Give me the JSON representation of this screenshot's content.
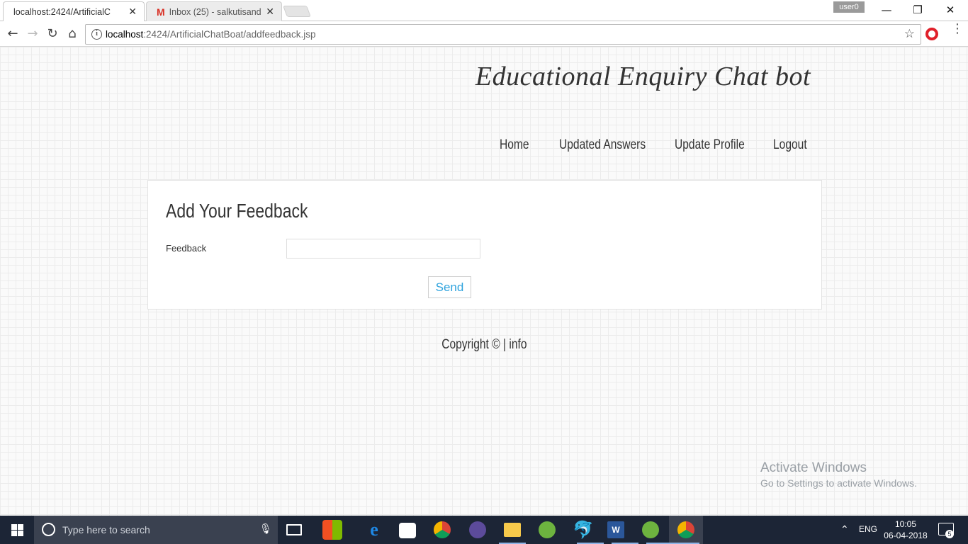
{
  "browser": {
    "tabs": [
      {
        "label": "localhost:2424/ArtificialC",
        "active": true
      },
      {
        "label": "Inbox (25) - salkutisande",
        "active": false,
        "icon": "gmail-icon"
      }
    ],
    "profile_name": "user0",
    "url_host": "localhost",
    "url_path": ":2424/ArtificialChatBoat/addfeedback.jsp"
  },
  "site": {
    "title": "Educational Enquiry Chat bot",
    "nav": [
      "Home",
      "Updated Answers",
      "Update Profile",
      "Logout"
    ]
  },
  "form": {
    "heading": "Add Your Feedback",
    "feedback_label": "Feedback",
    "feedback_value": "",
    "send_label": "Send"
  },
  "footer": {
    "text": "Copyright © | info"
  },
  "watermark": {
    "line1": "Activate Windows",
    "line2": "Go to Settings to activate Windows."
  },
  "taskbar": {
    "search_placeholder": "Type here to search",
    "language": "ENG",
    "time": "10:05",
    "date": "06-04-2018",
    "notifications": "5",
    "apps": [
      "task-view",
      "store-tiles",
      "edge",
      "store",
      "chrome",
      "eclipse",
      "file-explorer",
      "spring",
      "mysql",
      "word",
      "spring-2",
      "chrome-active"
    ]
  },
  "colors": {
    "accent_link": "#2fa3dd",
    "taskbar_bg": "#1c2536",
    "page_grid": "#ececec"
  }
}
